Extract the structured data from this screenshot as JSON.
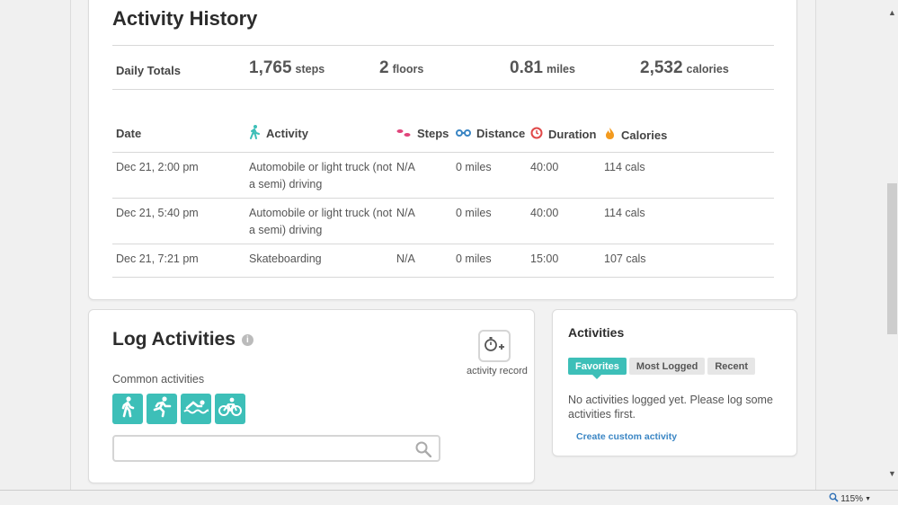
{
  "history": {
    "title": "Activity History",
    "totals": {
      "label": "Daily Totals",
      "steps": {
        "value": "1,765",
        "unit": "steps"
      },
      "floors": {
        "value": "2",
        "unit": "floors"
      },
      "miles": {
        "value": "0.81",
        "unit": "miles"
      },
      "calories": {
        "value": "2,532",
        "unit": "calories"
      }
    },
    "columns": {
      "date": "Date",
      "activity": "Activity",
      "steps": "Steps",
      "distance": "Distance",
      "duration": "Duration",
      "calories": "Calories"
    },
    "rows": [
      {
        "date": "Dec 21, 2:00 pm",
        "activity_line1": "Automobile or light truck (not",
        "activity_line2": "a semi) driving",
        "steps": "N/A",
        "distance": "0 miles",
        "duration": "40:00",
        "calories": "114 cals"
      },
      {
        "date": "Dec 21, 5:40 pm",
        "activity_line1": "Automobile or light truck (not",
        "activity_line2": "a semi) driving",
        "steps": "N/A",
        "distance": "0 miles",
        "duration": "40:00",
        "calories": "114 cals"
      },
      {
        "date": "Dec 21, 7:21 pm",
        "activity_line1": "Skateboarding",
        "activity_line2": "",
        "steps": "N/A",
        "distance": "0 miles",
        "duration": "15:00",
        "calories": "107 cals"
      }
    ]
  },
  "log": {
    "title": "Log Activities",
    "info_icon": "info-icon",
    "common_label": "Common activities",
    "common_icons": [
      "walk-icon",
      "run-icon",
      "swim-icon",
      "bike-icon"
    ],
    "search_placeholder": "",
    "record_label": "activity record"
  },
  "side": {
    "title": "Activities",
    "tabs": [
      "Favorites",
      "Most Logged",
      "Recent"
    ],
    "message": "No activities logged yet. Please log some activities first.",
    "custom_link": "Create custom activity"
  },
  "status": {
    "zoom": "115%"
  },
  "colors": {
    "accent": "#3dbfb8",
    "link": "#3b86c4"
  }
}
